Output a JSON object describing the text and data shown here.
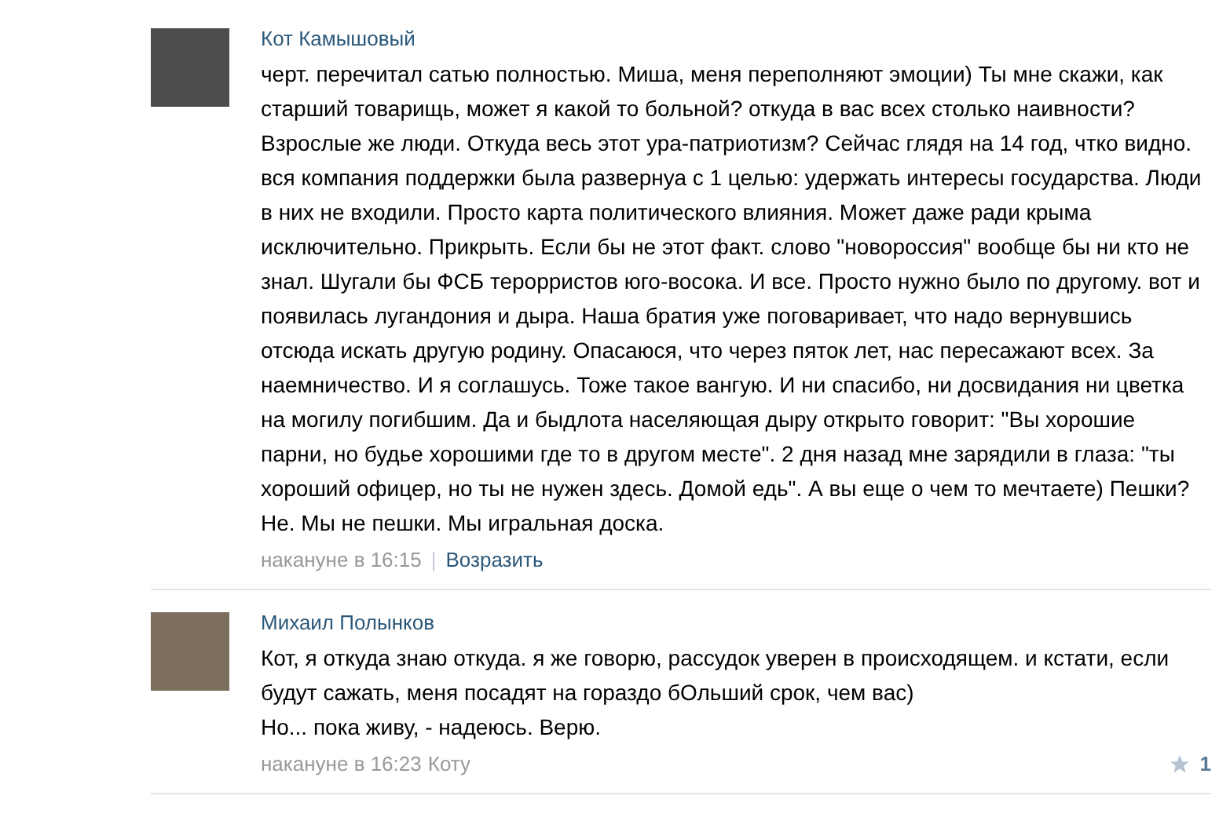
{
  "comments": [
    {
      "author": "Кот Камышовый",
      "paragraphs": [
        "черт. перечитал сатью полностью. Миша, меня переполняют эмоции) Ты мне скажи, как старший товарищь, может я какой то больной? откуда в вас всех столько наивности? Взрослые же люди. Откуда весь этот ура-патриотизм? Сейчас глядя на 14 год, чтко видно. вся компания поддержки была развернуа с 1 целью: удержать интересы государства. Люди в них не входили. Просто карта политического влияния. Может даже ради крыма исключительно. Прикрыть. Если бы не этот факт. слово \"новороссия\" вообще бы ни кто не знал. Шугали бы ФСБ терорристов юго-восока. И все. Просто нужно было по другому. вот и появилась лугандония и дыра. Наша братия уже поговаривает, что надо вернувшись отсюда искать другую родину. Опасаюся, что через пяток лет, нас пересажают всех. За наемничество. И я соглашусь. Тоже такое вангую. И ни спасибо, ни досвидания ни цветка на могилу погибшим. Да и быдлота населяющая дыру открыто говорит: \"Вы хорошие парни, но будье хорошими где то в другом месте\". 2 дня назад мне зарядили в глаза: \"ты хороший офицер, но ты не нужен здесь. Домой едь\". А вы еще о чем то мечтаете) Пешки? Не. Мы не пешки. Мы игральная доска."
      ],
      "time": "накануне в 16:15",
      "separator": "|",
      "action": "Возразить"
    },
    {
      "author": "Михаил Полынков",
      "paragraphs": [
        "Кот, я откуда знаю откуда. я же говорю, рассудок уверен в происходящем. и кстати, если будут сажать, меня посадят на гораздо бОльший срок, чем вас)",
        "Но... пока живу, - надеюсь. Верю."
      ],
      "time": "накануне в 16:23",
      "reply_to": "Коту",
      "likes": "1"
    }
  ]
}
